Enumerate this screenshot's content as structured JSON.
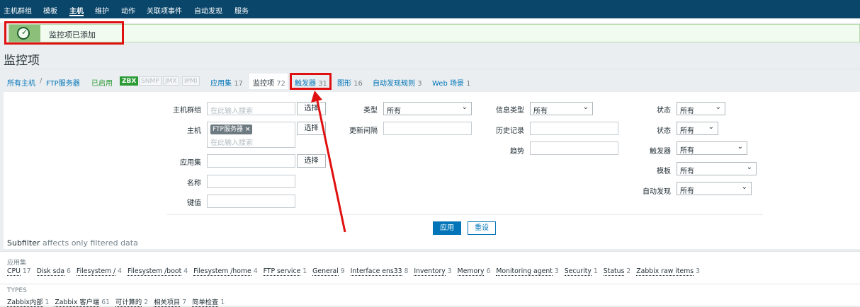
{
  "nav": {
    "items": [
      "主机群组",
      "模板",
      "主机",
      "维护",
      "动作",
      "关联项事件",
      "自动发现",
      "服务"
    ],
    "active_index": 2
  },
  "message": {
    "text": "监控项已添加",
    "icon": "check-circle-icon"
  },
  "page": {
    "title": "监控项"
  },
  "breadcrumb": {
    "all_hosts": "所有主机",
    "separator": "/",
    "host": "FTP服务器",
    "status": "已启用"
  },
  "availability": [
    "ZBX",
    "SNMP",
    "JMX",
    "IPMI"
  ],
  "tabs": [
    {
      "label": "应用集",
      "count": "17"
    },
    {
      "label": "监控项",
      "count": "72"
    },
    {
      "label": "触发器",
      "count": "31"
    },
    {
      "label": "图形",
      "count": "16"
    },
    {
      "label": "自动发现规则",
      "count": "3"
    },
    {
      "label": "Web 场景",
      "count": "1"
    }
  ],
  "filter": {
    "host_group_label": "主机群组",
    "host_group_placeholder": "在此输入搜索",
    "select_label": "选择",
    "host_label": "主机",
    "host_tag": "FTP服务器",
    "tag_remove": "×",
    "host_placeholder": "在此输入搜索",
    "app_label": "应用集",
    "name_label": "名称",
    "key_label": "键值",
    "type_label": "类型",
    "type_value": "所有",
    "interval_label": "更新间隔",
    "info_type_label": "信息类型",
    "info_type_value": "所有",
    "history_label": "历史记录",
    "trend_label": "趋势",
    "state_label": "状态",
    "state_value": "所有",
    "status_label": "状态",
    "status_value": "所有",
    "triggers_label": "触发器",
    "triggers_value": "所有",
    "template_label": "模板",
    "template_value": "所有",
    "discovery_label": "自动发现",
    "discovery_value": "所有",
    "apply": "应用",
    "reset": "重设"
  },
  "subfilter": {
    "title": "Subfilter",
    "note": "affects only filtered data",
    "apps_header": "应用集",
    "apps": [
      {
        "name": "CPU",
        "count": "17"
      },
      {
        "name": "Disk sda",
        "count": "6"
      },
      {
        "name": "Filesystem /",
        "count": "4"
      },
      {
        "name": "Filesystem /boot",
        "count": "4"
      },
      {
        "name": "Filesystem /home",
        "count": "4"
      },
      {
        "name": "FTP service",
        "count": "1"
      },
      {
        "name": "General",
        "count": "9"
      },
      {
        "name": "Interface ens33",
        "count": "8"
      },
      {
        "name": "Inventory",
        "count": "3"
      },
      {
        "name": "Memory",
        "count": "6"
      },
      {
        "name": "Monitoring agent",
        "count": "3"
      },
      {
        "name": "Security",
        "count": "1"
      },
      {
        "name": "Status",
        "count": "2"
      },
      {
        "name": "Zabbix raw items",
        "count": "3"
      }
    ],
    "types_header": "TYPES",
    "types": [
      {
        "name": "Zabbix内部",
        "count": "1"
      },
      {
        "name": "Zabbix 客户端",
        "count": "61"
      },
      {
        "name": "可计算的",
        "count": "2"
      },
      {
        "name": "相关项目",
        "count": "7"
      },
      {
        "name": "简单检查",
        "count": "1"
      }
    ]
  },
  "colors": {
    "nav_bg": "#0a466a",
    "link": "#0275b8",
    "annotation_red": "#e01010",
    "success_green": "#2b9b36"
  }
}
